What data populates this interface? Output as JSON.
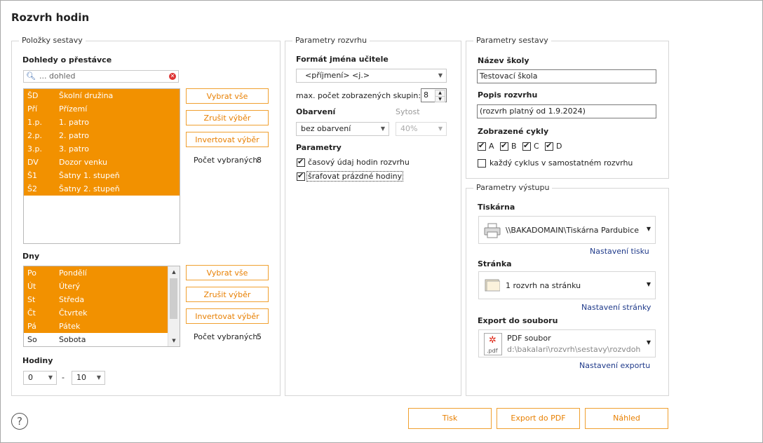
{
  "window_title": "Rozvrh hodin",
  "polozky": {
    "group_title": "Položky sestavy",
    "dohledy_label": "Dohledy o přestávce",
    "search_placeholder": "... dohled",
    "dohledy_items": [
      {
        "code": "ŠD",
        "name": "Školní družina"
      },
      {
        "code": "Pří",
        "name": "Přízemí"
      },
      {
        "code": "1.p.",
        "name": "1. patro"
      },
      {
        "code": "2.p.",
        "name": "2. patro"
      },
      {
        "code": "3.p.",
        "name": "3. patro"
      },
      {
        "code": "DV",
        "name": "Dozor venku"
      },
      {
        "code": "Š1",
        "name": "Šatny 1. stupeň"
      },
      {
        "code": "Š2",
        "name": "Šatny 2. stupeň"
      }
    ],
    "btn_select_all": "Vybrat vše",
    "btn_deselect": "Zrušit výběr",
    "btn_invert": "Invertovat výběr",
    "selected_count_label": "Počet vybraných:",
    "dohledy_selected_count": "8",
    "dny_label": "Dny",
    "dny_items": [
      {
        "code": "Po",
        "name": "Pondělí",
        "selected": true
      },
      {
        "code": "Út",
        "name": "Úterý",
        "selected": true
      },
      {
        "code": "St",
        "name": "Středa",
        "selected": true
      },
      {
        "code": "Čt",
        "name": "Čtvrtek",
        "selected": true
      },
      {
        "code": "Pá",
        "name": "Pátek",
        "selected": true
      },
      {
        "code": "So",
        "name": "Sobota",
        "selected": false
      }
    ],
    "dny_selected_count": "5",
    "hodiny_label": "Hodiny",
    "hodiny_from": "0",
    "hodiny_sep": "-",
    "hodiny_to": "10"
  },
  "parametry_rozvrhu": {
    "group_title": "Parametry rozvrhu",
    "format_label": "Formát jména učitele",
    "format_value": "<příjmení> <j.>",
    "max_groups_label": "max. počet zobrazených skupin:",
    "max_groups_value": "8",
    "obarveni_label": "Obarvení",
    "obarveni_value": "bez obarvení",
    "sytost_label": "Sytost",
    "sytost_value": "40%",
    "params_label": "Parametry",
    "check_time_label": "časový údaj hodin rozvrhu",
    "check_time": true,
    "check_hatch_label": "šrafovat prázdné hodiny",
    "check_hatch": true
  },
  "parametry_sestavy": {
    "group_title": "Parametry sestavy",
    "school_name_label": "Název školy",
    "school_name_value": "Testovací škola",
    "desc_label": "Popis rozvrhu",
    "desc_value": "(rozvrh platný od 1.9.2024)",
    "cycles_label": "Zobrazené cykly",
    "cycles": [
      {
        "label": "A",
        "checked": true
      },
      {
        "label": "B",
        "checked": true
      },
      {
        "label": "C",
        "checked": true
      },
      {
        "label": "D",
        "checked": true
      }
    ],
    "each_cycle_label": "každý cyklus v samostatném rozvrhu",
    "each_cycle": false
  },
  "parametry_vystupu": {
    "group_title": "Parametry výstupu",
    "printer_label": "Tiskárna",
    "printer_value": "\\\\BAKADOMAIN\\Tiskárna Pardubice",
    "print_settings_link": "Nastavení tisku",
    "page_label": "Stránka",
    "page_value": "1 rozvrh na stránku",
    "page_settings_link": "Nastavení stránky",
    "export_label": "Export do souboru",
    "export_value": "PDF soubor",
    "export_path": "d:\\bakalari\\rozvrh\\sestavy\\rozvdohpr",
    "export_settings_link": "Nastavení exportu",
    "pdf_icon_text": ".pdf"
  },
  "footer": {
    "help_glyph": "?",
    "btn_print": "Tisk",
    "btn_export_pdf": "Export do PDF",
    "btn_preview": "Náhled"
  },
  "colors": {
    "selection": "#f29100",
    "button_text": "#e87f00",
    "link": "#1f3a8a"
  }
}
